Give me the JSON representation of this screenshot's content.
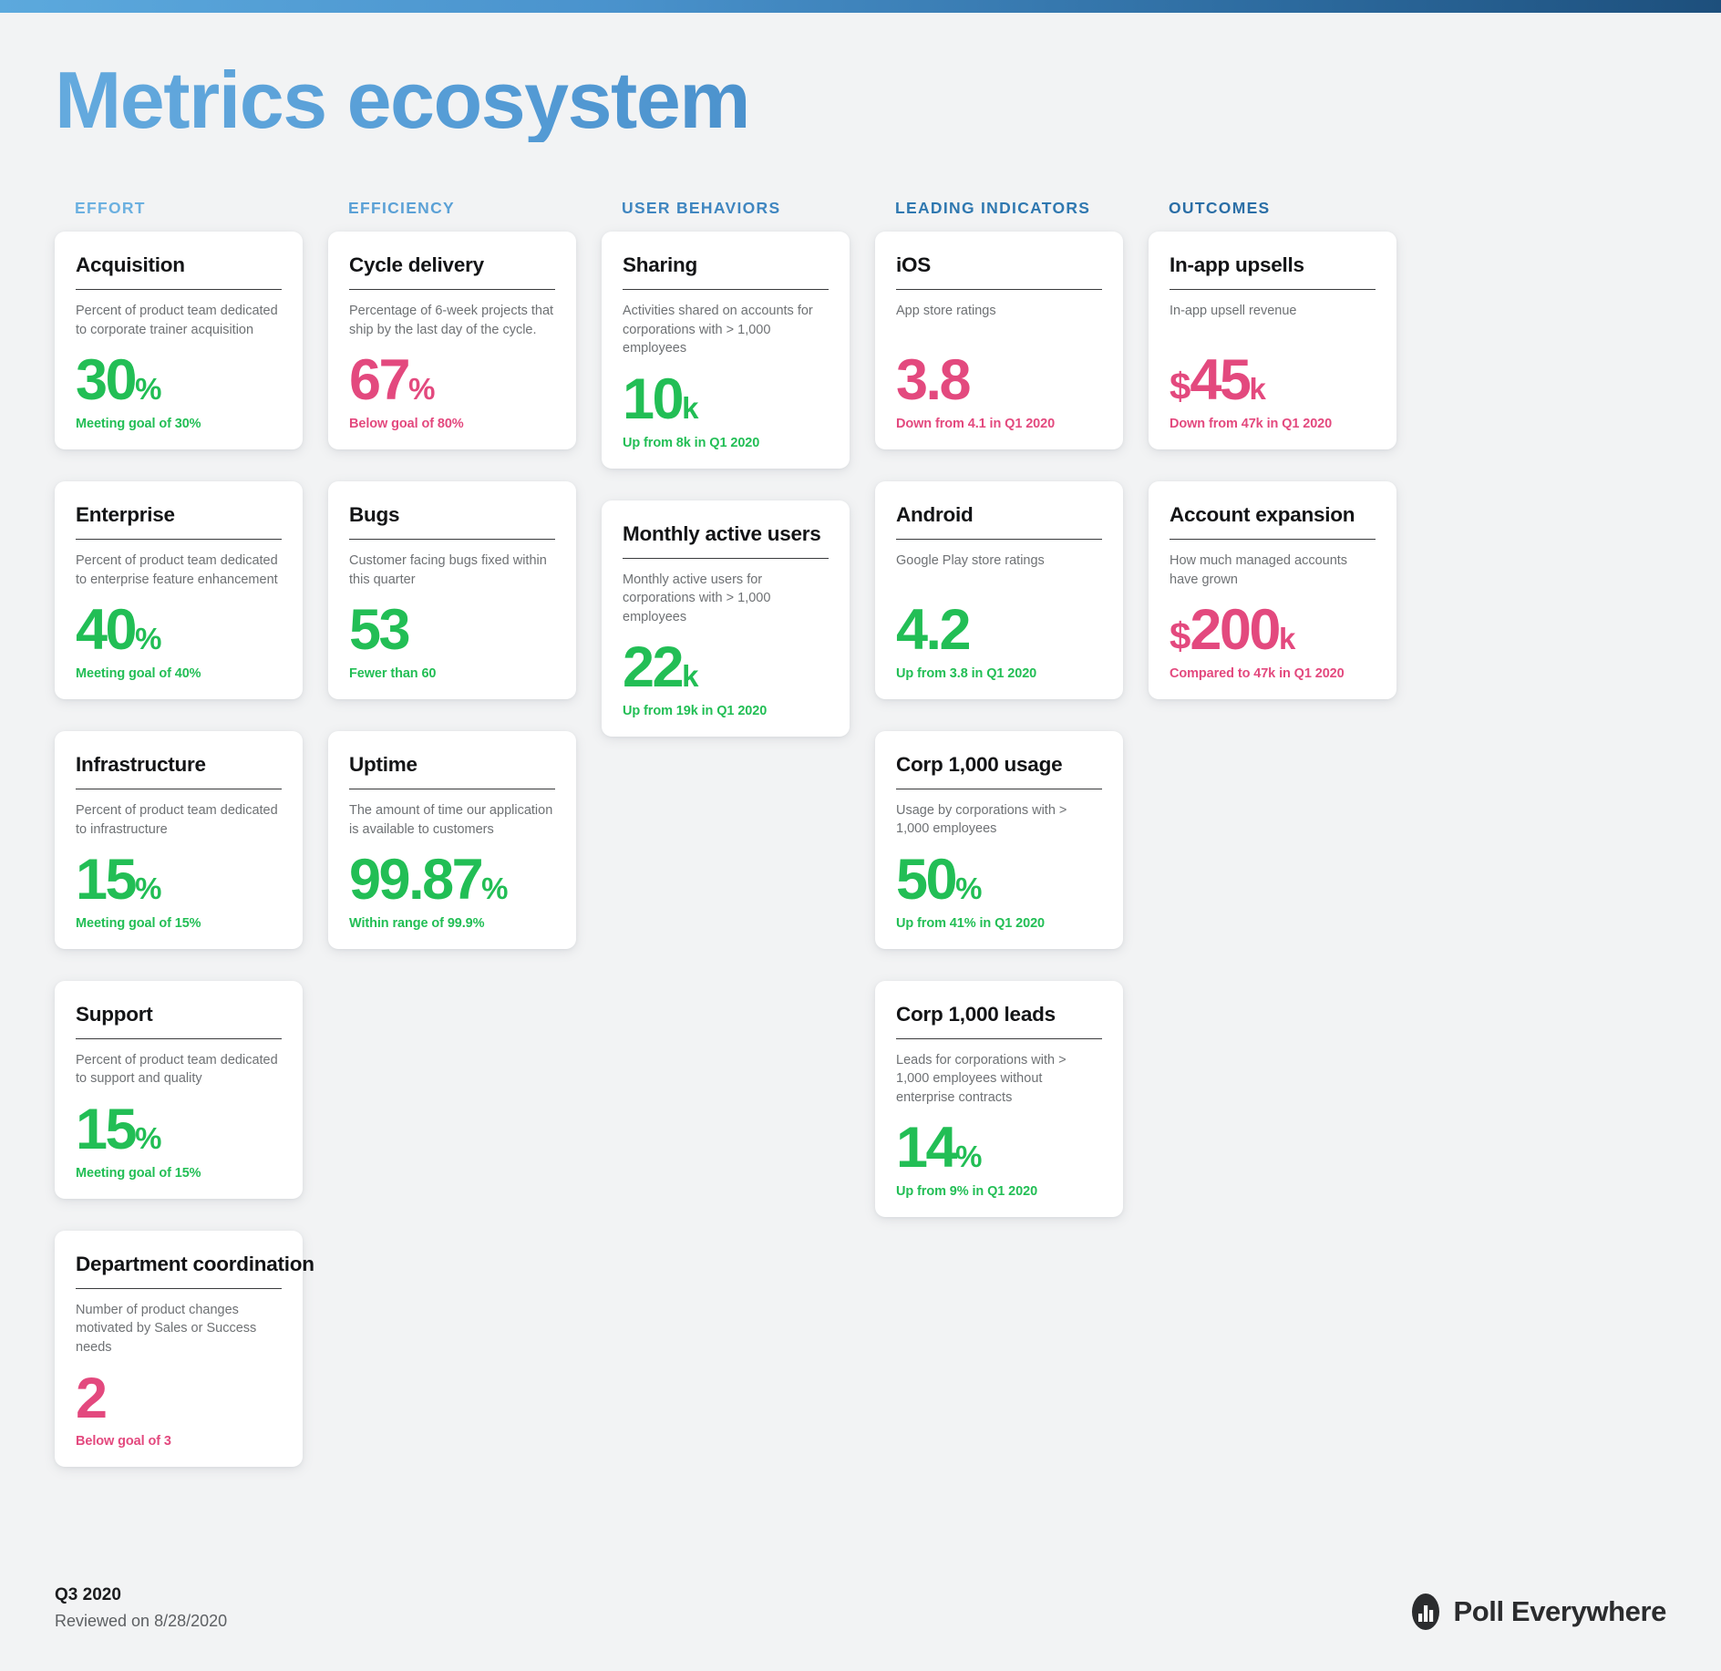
{
  "title": "Metrics ecosystem",
  "colors": {
    "positive": "#22be55",
    "negative": "#e3497e",
    "accent_light": "#64aade",
    "accent_dark": "#3477ae"
  },
  "columns": [
    {
      "header": "EFFORT",
      "cards": [
        {
          "title": "Acquisition",
          "description": "Percent of product team dedicated to corporate trainer acquisition",
          "value": "30",
          "suffix": "%",
          "prefix": "",
          "status": "Meeting goal of 30%",
          "tone": "positive"
        },
        {
          "title": "Enterprise",
          "description": "Percent of product team dedicated to enterprise feature enhancement",
          "value": "40",
          "suffix": "%",
          "prefix": "",
          "status": "Meeting goal of 40%",
          "tone": "positive"
        },
        {
          "title": "Infrastructure",
          "description": "Percent of product team dedicated to infrastructure",
          "value": "15",
          "suffix": "%",
          "prefix": "",
          "status": "Meeting goal of 15%",
          "tone": "positive"
        },
        {
          "title": "Support",
          "description": "Percent of product team dedicated to support and quality",
          "value": "15",
          "suffix": "%",
          "prefix": "",
          "status": "Meeting goal of 15%",
          "tone": "positive"
        },
        {
          "title": "Department coordination",
          "description": "Number of product changes motivated by Sales or Success needs",
          "value": "2",
          "suffix": "",
          "prefix": "",
          "status": "Below goal of 3",
          "tone": "negative"
        }
      ]
    },
    {
      "header": "EFFICIENCY",
      "cards": [
        {
          "title": "Cycle delivery",
          "description": "Percentage of 6-week projects that ship by the last day of the cycle.",
          "value": "67",
          "suffix": "%",
          "prefix": "",
          "status": "Below goal of 80%",
          "tone": "negative"
        },
        {
          "title": "Bugs",
          "description": "Customer facing bugs fixed within this quarter",
          "value": "53",
          "suffix": "",
          "prefix": "",
          "status": "Fewer than 60",
          "tone": "positive"
        },
        {
          "title": "Uptime",
          "description": "The amount of time our application is available to customers",
          "value": "99.87",
          "suffix": "%",
          "prefix": "",
          "status": "Within range of 99.9%",
          "tone": "positive"
        }
      ]
    },
    {
      "header": "USER BEHAVIORS",
      "cards": [
        {
          "title": "Sharing",
          "description": "Activities shared on accounts for corporations with > 1,000 employees",
          "value": "10",
          "suffix": "k",
          "prefix": "",
          "status": "Up from 8k in Q1 2020",
          "tone": "positive"
        },
        {
          "title": "Monthly active users",
          "description": "Monthly active users for corporations with > 1,000 employees",
          "value": "22",
          "suffix": "k",
          "prefix": "",
          "status": "Up from 19k in Q1 2020",
          "tone": "positive"
        }
      ]
    },
    {
      "header": "LEADING INDICATORS",
      "cards": [
        {
          "title": "iOS",
          "description": "App store ratings",
          "value": "3.8",
          "suffix": "",
          "prefix": "",
          "status": "Down from 4.1 in Q1 2020",
          "tone": "negative"
        },
        {
          "title": "Android",
          "description": "Google Play store ratings",
          "value": "4.2",
          "suffix": "",
          "prefix": "",
          "status": "Up from 3.8 in Q1 2020",
          "tone": "positive"
        },
        {
          "title": "Corp 1,000 usage",
          "description": "Usage by corporations with > 1,000 employees",
          "value": "50",
          "suffix": "%",
          "prefix": "",
          "status": "Up from 41% in Q1 2020",
          "tone": "positive"
        },
        {
          "title": "Corp 1,000 leads",
          "description": "Leads for corporations with > 1,000 employees without enterprise contracts",
          "value": "14",
          "suffix": "%",
          "prefix": "",
          "status": "Up from 9% in Q1 2020",
          "tone": "positive"
        }
      ]
    },
    {
      "header": "OUTCOMES",
      "cards": [
        {
          "title": "In-app upsells",
          "description": "In-app upsell revenue",
          "value": "45",
          "suffix": "k",
          "prefix": "$",
          "status": "Down from 47k in Q1 2020",
          "tone": "negative"
        },
        {
          "title": "Account expansion",
          "description": "How much managed accounts have grown",
          "value": "200",
          "suffix": "k",
          "prefix": "$",
          "status": "Compared to 47k in Q1 2020",
          "tone": "negative"
        }
      ]
    }
  ],
  "footer": {
    "quarter": "Q3 2020",
    "reviewed": "Reviewed on 8/28/2020",
    "logo_text": "Poll Everywhere"
  }
}
